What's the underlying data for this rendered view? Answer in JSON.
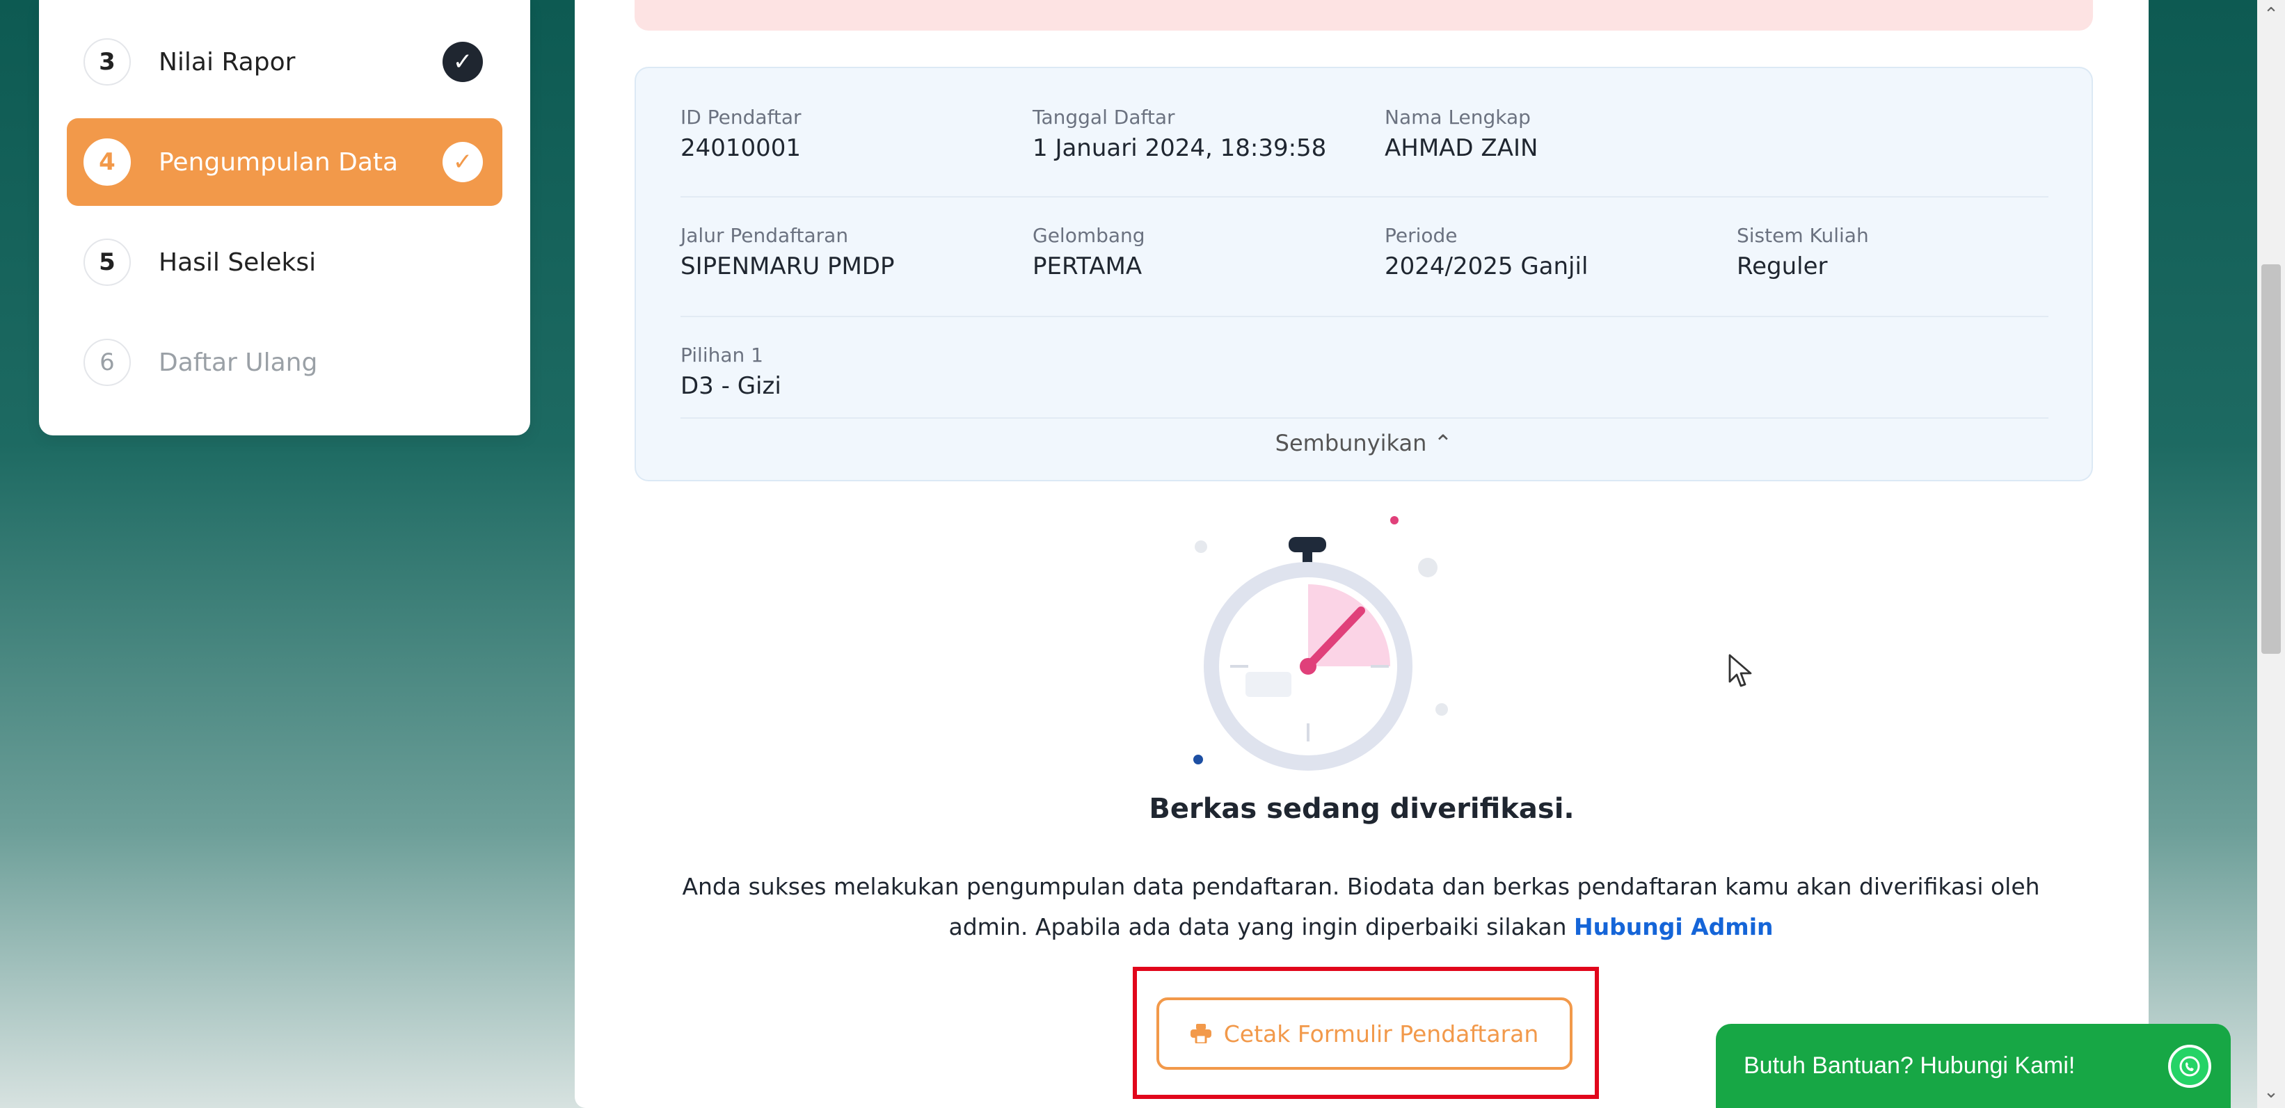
{
  "steps": [
    {
      "num": "3",
      "label": "Nilai Rapor",
      "state": "done"
    },
    {
      "num": "4",
      "label": "Pengumpulan Data",
      "state": "active"
    },
    {
      "num": "5",
      "label": "Hasil Seleksi",
      "state": "pending"
    },
    {
      "num": "6",
      "label": "Daftar Ulang",
      "state": "disabled"
    }
  ],
  "info": {
    "id_label": "ID Pendaftar",
    "id_value": "24010001",
    "tanggal_label": "Tanggal Daftar",
    "tanggal_value": "1 Januari 2024, 18:39:58",
    "nama_label": "Nama Lengkap",
    "nama_value": "AHMAD ZAIN",
    "jalur_label": "Jalur Pendaftaran",
    "jalur_value": "SIPENMARU PMDP",
    "gelombang_label": "Gelombang",
    "gelombang_value": "PERTAMA",
    "periode_label": "Periode",
    "periode_value": "2024/2025 Ganjil",
    "sistem_label": "Sistem Kuliah",
    "sistem_value": "Reguler",
    "pilihan_label": "Pilihan 1",
    "pilihan_value": "D3 - Gizi",
    "toggle_label": "Sembunyikan ⌃"
  },
  "status": {
    "title": "Berkas sedang diverifikasi.",
    "desc_line1": "Anda sukses melakukan pengumpulan data pendaftaran. Biodata dan berkas pendaftaran kamu akan diverifikasi oleh",
    "desc_line2": "admin. Apabila ada data yang ingin diperbaiki silakan",
    "contact_link": "Hubungi Admin"
  },
  "print_button": {
    "label": "Cetak Formulir Pendaftaran",
    "icon": "printer-icon"
  },
  "help": {
    "label": "Butuh Bantuan? Hubungi Kami!",
    "icon": "whatsapp-icon"
  },
  "colors": {
    "accent": "#f2994a",
    "link": "#1565d8",
    "whatsapp": "#17a745",
    "highlight": "#e1061b"
  }
}
